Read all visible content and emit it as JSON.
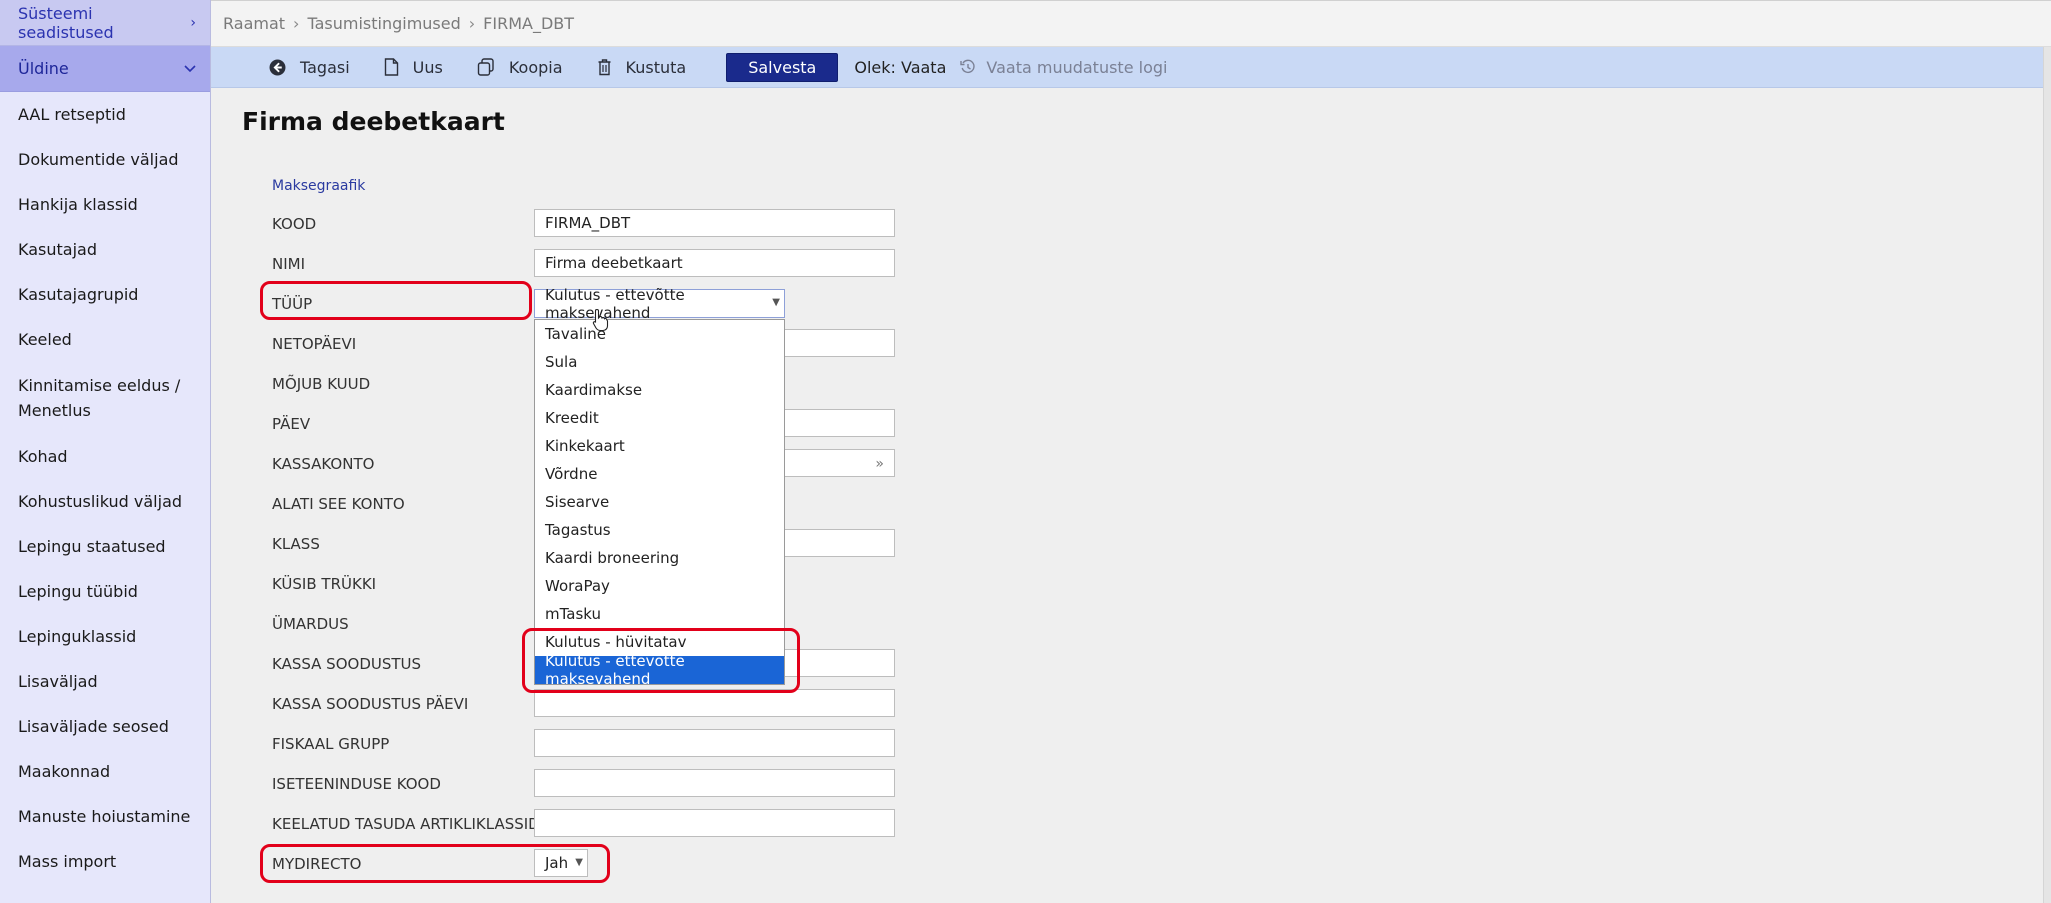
{
  "sidebar": {
    "system_settings": "Süsteemi seadistused",
    "general": "Üldine",
    "items": [
      "AAL retseptid",
      "Dokumentide väljad",
      "Hankija klassid",
      "Kasutajad",
      "Kasutajagrupid",
      "Keeled",
      "Kinnitamise eeldus / Menetlus",
      "Kohad",
      "Kohustuslikud väljad",
      "Lepingu staatused",
      "Lepingu tüübid",
      "Lepinguklassid",
      "Lisaväljad",
      "Lisaväljade seosed",
      "Maakonnad",
      "Manuste hoiustamine",
      "Mass import"
    ]
  },
  "breadcrumb": [
    "Raamat",
    "Tasumistingimused",
    "FIRMA_DBT"
  ],
  "toolbar": {
    "back": "Tagasi",
    "new": "Uus",
    "copy": "Koopia",
    "delete": "Kustuta",
    "save": "Salvesta",
    "status": "Olek: Vaata",
    "log": "Vaata muudatuste logi"
  },
  "page_title": "Firma deebetkaart",
  "section_link": "Maksegraafik",
  "fields": {
    "kood": "KOOD",
    "nimi": "NIMI",
    "tyyp": "TÜÜP",
    "netopaevi": "NETOPÄEVI",
    "mojub_kuud": "MÕJUB KUUD",
    "paev": "PÄEV",
    "kassakonto": "KASSAKONTO",
    "alati_see_konto": "ALATI SEE KONTO",
    "klass": "KLASS",
    "kysib_trykki": "KÜSIB TRÜKKI",
    "umardus": "ÜMARDUS",
    "kassa_soodustus": "KASSA SOODUSTUS",
    "kassa_soodustus_paevi": "KASSA SOODUSTUS PÄEVI",
    "fiskaal_grupp": "FISKAAL GRUPP",
    "iseteeninduse_kood": "ISETEENINDUSE KOOD",
    "keelatud_tasuda": "KEELATUD TASUDA ARTIKLIKLASSID",
    "mydirecto": "MYDIRECTO"
  },
  "values": {
    "kood": "FIRMA_DBT",
    "nimi": "Firma deebetkaart",
    "tyyp": "Kulutus - ettevõtte maksevahend",
    "mydirecto": "Jah"
  },
  "dropdown_options": [
    "Tavaline",
    "Sula",
    "Kaardimakse",
    "Kreedit",
    "Kinkekaart",
    "Võrdne",
    "Sisearve",
    "Tagastus",
    "Kaardi broneering",
    "WoraPay",
    "mTasku",
    "Kulutus - hüvitatav",
    "Kulutus - ettevõtte maksevahend"
  ],
  "dropdown_selected_index": 12,
  "colors": {
    "highlight": "#e2001a",
    "save_button": "#1a2a8c",
    "toolbar_bg": "#c9d9f5",
    "option_selected": "#1a65d6"
  }
}
